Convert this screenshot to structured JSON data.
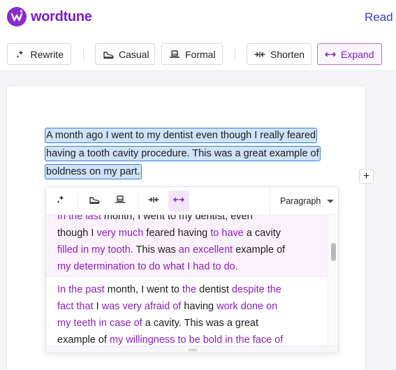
{
  "app": {
    "brand": "wordtune",
    "read_link": "Read &",
    "accent": "#7a1fc7",
    "link_color": "#3a3ad6"
  },
  "toolbar": {
    "rewrite": "Rewrite",
    "casual": "Casual",
    "formal": "Formal",
    "shorten": "Shorten",
    "expand": "Expand",
    "active": "Expand"
  },
  "document": {
    "selected_lines": [
      "A month ago I went to my dentist even though I really feared",
      "having a tooth cavity procedure. This was a great example of",
      "boldness on my part."
    ],
    "plus_label": "+"
  },
  "popup": {
    "mode": "Paragraph",
    "icons": [
      "rewrite-icon",
      "casual-icon",
      "formal-icon",
      "shorten-icon",
      "expand-icon"
    ],
    "suggestions": [
      [
        {
          "t": "In the last",
          "c": true
        },
        {
          "t": " month, I went to my dentist, even ",
          "c": false
        },
        {
          "t": "\n",
          "c": false
        },
        {
          "t": "though I ",
          "c": false
        },
        {
          "t": "very much",
          "c": true
        },
        {
          "t": " feared having ",
          "c": false
        },
        {
          "t": "to have",
          "c": true
        },
        {
          "t": " a cavity",
          "c": false
        },
        {
          "t": "\n",
          "c": false
        },
        {
          "t": "filled in my tooth",
          "c": true
        },
        {
          "t": ". This was ",
          "c": false
        },
        {
          "t": "an excellent",
          "c": true
        },
        {
          "t": " example of",
          "c": false
        },
        {
          "t": "\n",
          "c": false
        },
        {
          "t": "my determination to do what I had to do",
          "c": true
        },
        {
          "t": ".",
          "c": false
        }
      ],
      [
        {
          "t": "In the past",
          "c": true
        },
        {
          "t": " month, I went to ",
          "c": false
        },
        {
          "t": "the",
          "c": true
        },
        {
          "t": " dentist ",
          "c": false
        },
        {
          "t": "despite the",
          "c": true
        },
        {
          "t": "\n",
          "c": false
        },
        {
          "t": "fact that",
          "c": true
        },
        {
          "t": " I ",
          "c": false
        },
        {
          "t": "was very afraid of",
          "c": true
        },
        {
          "t": " having ",
          "c": false
        },
        {
          "t": "work done on",
          "c": true
        },
        {
          "t": "\n",
          "c": false
        },
        {
          "t": "my teeth in case of",
          "c": true
        },
        {
          "t": " a cavity. This was a great",
          "c": false
        },
        {
          "t": "\n",
          "c": false
        },
        {
          "t": "example of ",
          "c": false
        },
        {
          "t": "my willingness to be bold in the face of",
          "c": true
        }
      ]
    ]
  }
}
